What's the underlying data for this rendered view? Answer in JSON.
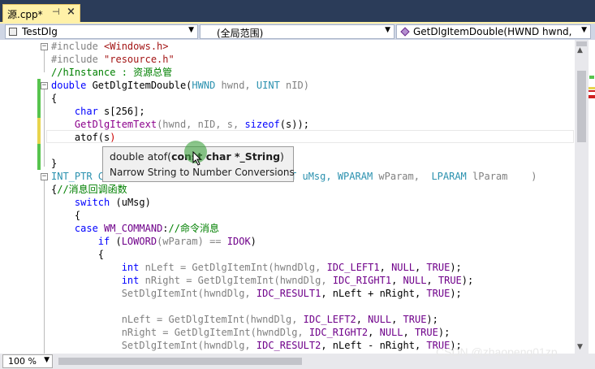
{
  "tab": {
    "title": "源.cpp*",
    "pin_glyph": "⊣",
    "close_glyph": "×"
  },
  "navbar": {
    "project": "TestDlg",
    "scope": "(全局范围)",
    "member": "GetDlgItemDouble(HWND hwnd, U"
  },
  "code": {
    "lines": [
      [
        "#include ",
        "<Windows.h>"
      ],
      [
        "#include ",
        "\"resource.h\""
      ],
      [
        "//hInstance : 资源总管"
      ],
      [
        "double ",
        "GetDlgItemDouble(",
        "HWND",
        " hwnd, ",
        "UINT",
        " nID)"
      ],
      [
        "{"
      ],
      [
        "    ",
        "char",
        " s[256];"
      ],
      [
        "    ",
        "GetDlgItemText",
        "(hwnd, nID, s, ",
        "sizeof",
        "(s));"
      ],
      [
        "    atof(s",
        ")"
      ],
      [
        ""
      ],
      [
        "}"
      ],
      [
        "INT_PTR C",
        "T uMsg, ",
        "WPARAM",
        " wParam,  ",
        "LPARAM",
        " lParam    )"
      ],
      [
        "{",
        "//消息回调函数"
      ],
      [
        "    ",
        "switch",
        " (uMsg)"
      ],
      [
        "    {"
      ],
      [
        "    ",
        "case",
        " ",
        "WM_COMMAND",
        ":",
        "//命令消息"
      ],
      [
        "        ",
        "if",
        " (",
        "LOWORD",
        "(wParam) == ",
        "IDOK",
        ")"
      ],
      [
        "        {"
      ],
      [
        "            ",
        "int",
        " nLeft = GetDlgItemInt(hwndDlg, ",
        "IDC_LEFT1",
        ", ",
        "NULL",
        ", ",
        "TRUE",
        ");"
      ],
      [
        "            ",
        "int",
        " nRight = GetDlgItemInt(hwndDlg, ",
        "IDC_RIGHT1",
        ", ",
        "NULL",
        ", ",
        "TRUE",
        ");"
      ],
      [
        "            SetDlgItemInt(hwndDlg, ",
        "IDC_RESULT1",
        ", nLeft + nRight, ",
        "TRUE",
        ");"
      ],
      [
        ""
      ],
      [
        "            nLeft = GetDlgItemInt(hwndDlg, ",
        "IDC_LEFT2",
        ", ",
        "NULL",
        ", ",
        "TRUE",
        ");"
      ],
      [
        "            nRight = GetDlgItemInt(hwndDlg, ",
        "IDC_RIGHT2",
        ", ",
        "NULL",
        ", ",
        "TRUE",
        ");"
      ],
      [
        "            SetDlgItemInt(hwndDlg, ",
        "IDC_RESULT2",
        ", nLeft - nRight, ",
        "TRUE",
        ");"
      ]
    ]
  },
  "tooltip": {
    "sig_prefix": "double atof(",
    "sig_bold": "const char *_String",
    "sig_suffix": ")",
    "description": "Narrow String to Number Conversions"
  },
  "status": {
    "zoom": "100 %"
  },
  "watermark": "CSDN @zhaopeng01zp",
  "colors": {
    "tab_bg": "#fff1a8",
    "keyword": "#0000ff",
    "macro": "#6f008a",
    "comment": "#008000",
    "string": "#a31515",
    "type": "#2b91af",
    "change_saved": "#57c44e",
    "change_unsaved": "#e8d44d"
  },
  "icons": [
    "class-icon",
    "method-icon",
    "dropdown-arrow-icon",
    "collapse-icon",
    "expand-icon",
    "mouse-cursor-icon"
  ]
}
